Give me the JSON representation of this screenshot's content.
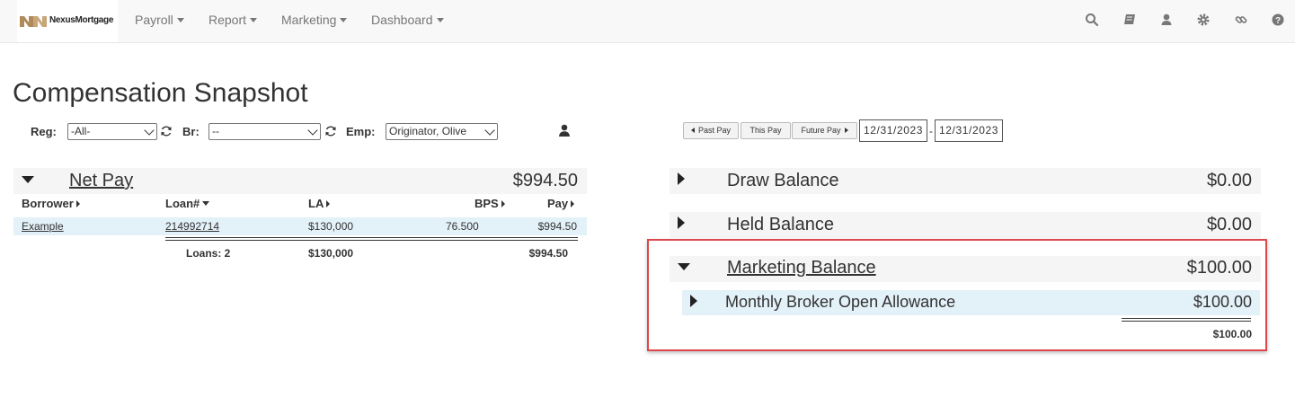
{
  "navbar": {
    "brand": "NexusMortgage",
    "menu": [
      {
        "label": "Payroll"
      },
      {
        "label": "Report"
      },
      {
        "label": "Marketing"
      },
      {
        "label": "Dashboard"
      }
    ],
    "icons": [
      "search-icon",
      "book-icon",
      "user-icon",
      "gear-icon",
      "link-icon",
      "help-icon"
    ]
  },
  "page": {
    "title": "Compensation Snapshot"
  },
  "filters": {
    "reg_label": "Reg:",
    "reg_value": "-All-",
    "br_label": "Br:",
    "br_value": "--",
    "emp_label": "Emp:",
    "emp_value": "Originator, Olive"
  },
  "pay_period": {
    "past": "Past Pay",
    "this": "This Pay",
    "future": "Future Pay",
    "start_date": "12/31/2023",
    "end_date": "12/31/2023",
    "separator": "-"
  },
  "net_pay": {
    "label": "Net Pay",
    "amount": "$994.50",
    "columns": {
      "borrower": "Borrower",
      "loan": "Loan#",
      "la": "LA",
      "bps": "BPS",
      "pay": "Pay"
    },
    "rows": [
      {
        "borrower": "Example",
        "loan": "214992714",
        "la": "$130,000",
        "bps": "76.500",
        "pay": "$994.50"
      }
    ],
    "totals": {
      "loans": "Loans: 2",
      "la": "$130,000",
      "pay": "$994.50"
    }
  },
  "balances": {
    "draw": {
      "label": "Draw Balance",
      "amount": "$0.00"
    },
    "held": {
      "label": "Held Balance",
      "amount": "$0.00"
    },
    "marketing": {
      "label": "Marketing Balance",
      "amount": "$100.00",
      "items": [
        {
          "label": "Monthly Broker Open Allowance",
          "amount": "$100.00"
        }
      ],
      "total": "$100.00"
    }
  },
  "colors": {
    "highlight": "#e0474c",
    "row_highlight": "#e3f1f8",
    "panel_bg": "#f5f5f5"
  }
}
